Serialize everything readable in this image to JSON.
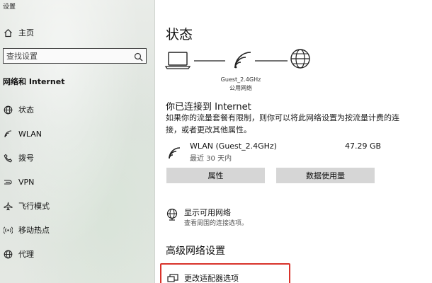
{
  "window": {
    "title": "设置"
  },
  "sidebar": {
    "home_label": "主页",
    "search_placeholder": "查找设置",
    "section_title": "网络和 Internet",
    "items": [
      {
        "label": "状态",
        "icon": "globe-icon"
      },
      {
        "label": "WLAN",
        "icon": "wifi-icon"
      },
      {
        "label": "拨号",
        "icon": "phone-icon"
      },
      {
        "label": "VPN",
        "icon": "vpn-icon"
      },
      {
        "label": "飞行模式",
        "icon": "airplane-icon"
      },
      {
        "label": "移动热点",
        "icon": "hotspot-icon"
      },
      {
        "label": "代理",
        "icon": "globe-icon"
      }
    ]
  },
  "main": {
    "title": "状态",
    "diagram": {
      "network_name": "Guest_2.4GHz",
      "network_type": "公用网络"
    },
    "connected_heading": "你已连接到 Internet",
    "connected_desc": "如果你的流量套餐有限制，则你可以将此网络设置为按流量计费的连接，或者更改其他属性。",
    "connection": {
      "name": "WLAN (Guest_2.4GHz)",
      "sub": "最近 30 天内",
      "usage": "47.29 GB"
    },
    "buttons": {
      "properties": "属性",
      "data_usage": "数据使用量"
    },
    "show_networks": {
      "title": "显示可用网络",
      "sub": "查看周围的连接选项。"
    },
    "advanced_heading": "高级网络设置",
    "change_adapter": "更改适配器选项"
  },
  "colors": {
    "highlight_border": "#d9332b",
    "button_bg": "#d6d6d6"
  }
}
